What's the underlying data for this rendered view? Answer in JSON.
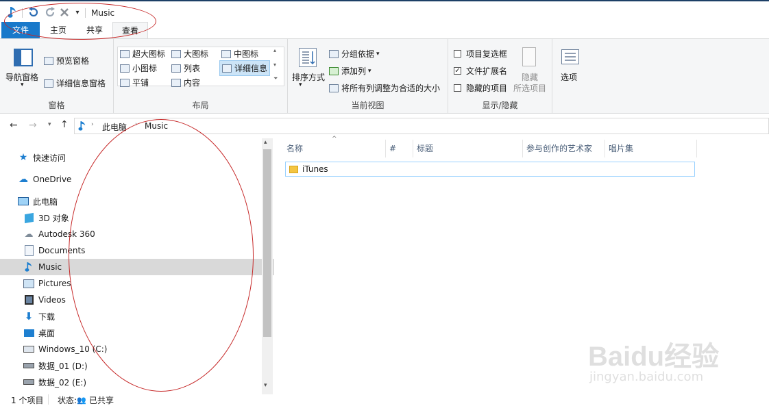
{
  "window": {
    "title": "Music"
  },
  "tabs": {
    "file": "文件",
    "home": "主页",
    "share": "共享",
    "view": "查看"
  },
  "ribbon": {
    "pane": {
      "nav_pane": "导航窗格",
      "preview_pane": "预览窗格",
      "details_pane": "详细信息窗格",
      "label": "窗格"
    },
    "layout": {
      "extra_large": "超大图标",
      "large": "大图标",
      "medium": "中图标",
      "small": "小图标",
      "list": "列表",
      "details": "详细信息",
      "tiles": "平铺",
      "content": "内容",
      "label": "布局"
    },
    "current_view": {
      "sort_by": "排序方式",
      "group_by": "分组依据",
      "add_columns": "添加列",
      "size_all_columns": "将所有列调整为合适的大小",
      "label": "当前视图"
    },
    "show_hide": {
      "item_checkboxes": "项目复选框",
      "file_extensions": "文件扩展名",
      "hidden_items": "隐藏的项目",
      "hide_selected_1": "隐藏",
      "hide_selected_2": "所选项目",
      "label": "显示/隐藏",
      "file_extensions_checked": true
    },
    "options": {
      "label": "选项"
    }
  },
  "address": {
    "root": "此电脑",
    "current": "Music"
  },
  "nav": {
    "quick_access": "快速访问",
    "onedrive": "OneDrive",
    "this_pc": "此电脑",
    "items": [
      {
        "label": "3D 对象",
        "icon": "3d-objects-icon"
      },
      {
        "label": "Autodesk 360",
        "icon": "cloud-icon"
      },
      {
        "label": "Documents",
        "icon": "documents-icon"
      },
      {
        "label": "Music",
        "icon": "music-icon"
      },
      {
        "label": "Pictures",
        "icon": "pictures-icon"
      },
      {
        "label": "Videos",
        "icon": "videos-icon"
      },
      {
        "label": "下载",
        "icon": "download-icon"
      },
      {
        "label": "桌面",
        "icon": "desktop-icon"
      },
      {
        "label": "Windows_10 (C:)",
        "icon": "drive-c-icon"
      },
      {
        "label": "数据_01 (D:)",
        "icon": "drive-icon"
      },
      {
        "label": "数据_02 (E:)",
        "icon": "drive-icon"
      }
    ]
  },
  "columns": {
    "name": "名称",
    "number": "#",
    "title": "标题",
    "artists": "参与创作的艺术家",
    "album": "唱片集"
  },
  "files": [
    {
      "name": "iTunes",
      "type": "folder"
    }
  ],
  "status": {
    "count": "1 个项目",
    "state": "状态:",
    "shared": "已共享"
  },
  "watermark": {
    "brand": "Baidu经验",
    "url": "jingyan.baidu.com"
  }
}
